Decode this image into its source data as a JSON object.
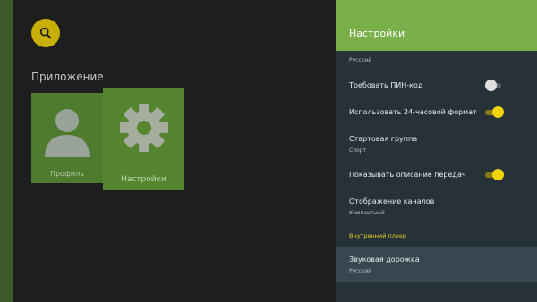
{
  "launcher": {
    "section_title": "Приложение",
    "apps": [
      {
        "label": "Профиль",
        "icon": "person-icon"
      },
      {
        "label": "Настройки",
        "icon": "gear-icon"
      }
    ]
  },
  "panel": {
    "title": "Настройки",
    "top_value": "Русский",
    "items": [
      {
        "title": "Требовать ПИН-код",
        "toggle": false
      },
      {
        "title": "Использовать 24-часовой формат",
        "toggle": true
      },
      {
        "title": "Стартовая группа",
        "value": "Спорт"
      },
      {
        "title": "Показывать описание передач",
        "toggle": true
      },
      {
        "title": "Отображение каналов",
        "value": "Компактный"
      }
    ],
    "category": "Внутренний плеер",
    "focused_item": {
      "title": "Звуковая дорожка",
      "value": "Русский"
    }
  },
  "colors": {
    "accent": "#7ab04a",
    "toggle_on": "#f2d400",
    "search_button": "#c9b000",
    "category_text": "#e0cc22"
  }
}
